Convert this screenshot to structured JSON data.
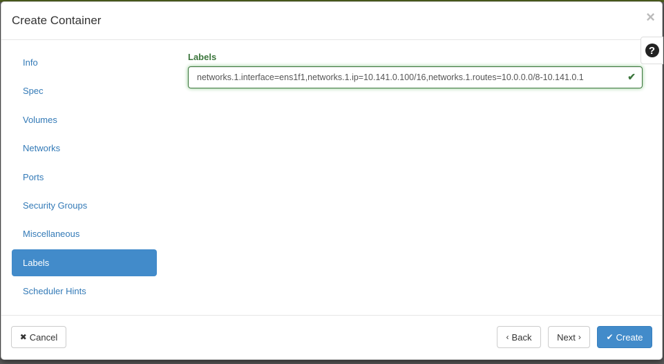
{
  "modal": {
    "title": "Create Container",
    "close_icon": "×",
    "help_icon": "?"
  },
  "sidebar": {
    "items": [
      {
        "label": "Info",
        "active": false
      },
      {
        "label": "Spec",
        "active": false
      },
      {
        "label": "Volumes",
        "active": false
      },
      {
        "label": "Networks",
        "active": false
      },
      {
        "label": "Ports",
        "active": false
      },
      {
        "label": "Security Groups",
        "active": false
      },
      {
        "label": "Miscellaneous",
        "active": false
      },
      {
        "label": "Labels",
        "active": true
      },
      {
        "label": "Scheduler Hints",
        "active": false
      }
    ]
  },
  "content": {
    "labels_field": {
      "label": "Labels",
      "value": "networks.1.interface=ens1f1,networks.1.ip=10.141.0.100/16,networks.1.routes=10.0.0.0/8-10.141.0.1",
      "valid_icon": "✔"
    }
  },
  "footer": {
    "cancel_label": "Cancel",
    "cancel_icon": "✖",
    "back_label": "Back",
    "back_icon": "‹",
    "next_label": "Next",
    "next_icon": "›",
    "create_label": "Create",
    "create_icon": "✔"
  },
  "colors": {
    "accent": "#428bca",
    "link": "#337ab7",
    "success": "#3c763d"
  }
}
